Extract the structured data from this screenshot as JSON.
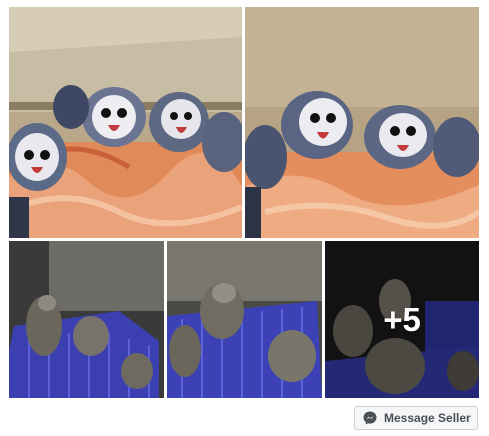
{
  "gallery": {
    "photos": [
      {
        "description": "Owl chicks on orange cloth"
      },
      {
        "description": "Owl chicks on orange cloth close"
      },
      {
        "description": "Chicks on blue crate"
      },
      {
        "description": "Chicks on blue crate"
      },
      {
        "description": "Chicks in dark corner"
      }
    ],
    "more_overlay": "+5"
  },
  "actions": {
    "message_seller": "Message Seller"
  },
  "colors": {
    "button_bg": "#f5f6f7",
    "button_border": "#ccd0d5",
    "button_text": "#4b4f56",
    "messenger_blue": "#4b4f56"
  }
}
